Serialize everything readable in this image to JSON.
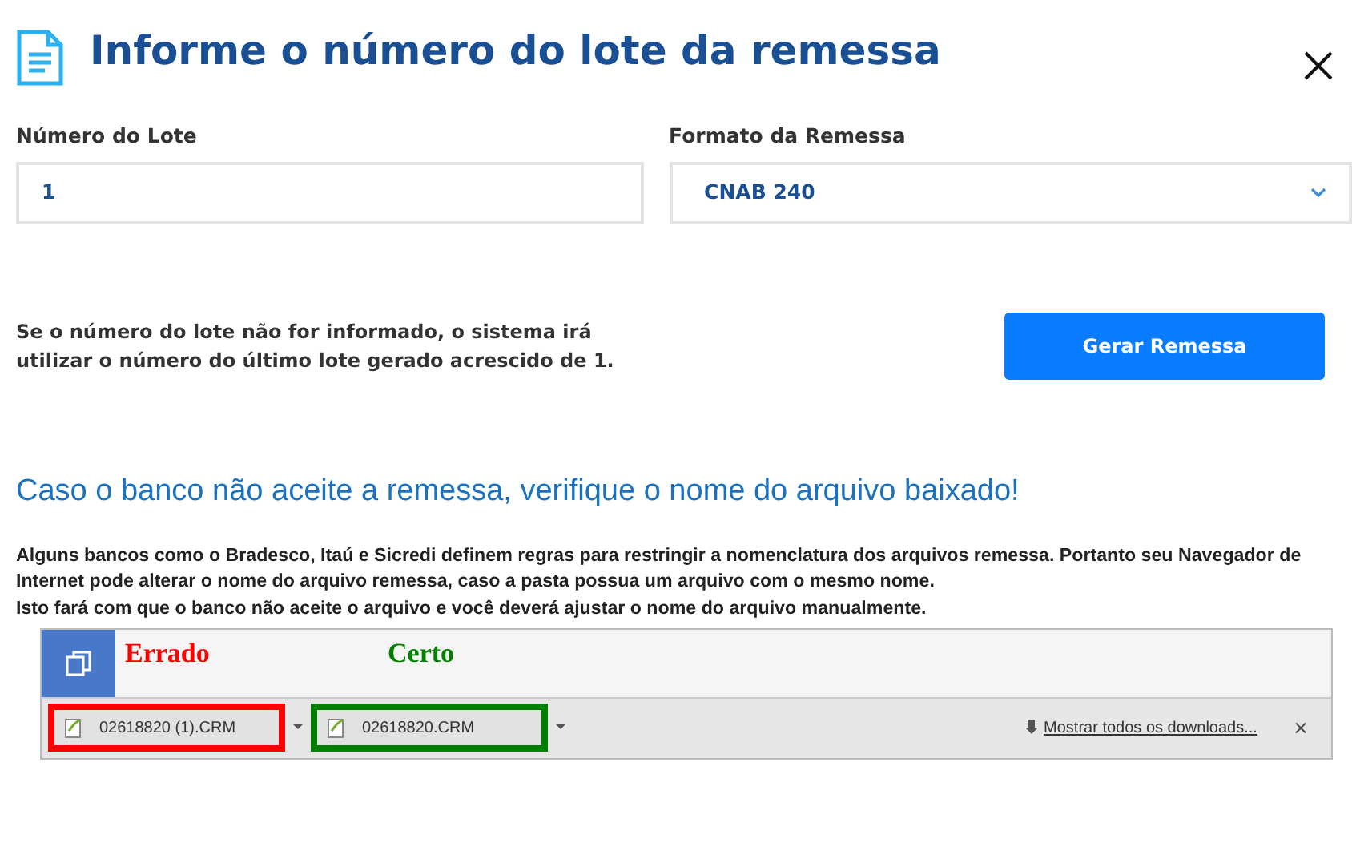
{
  "dialog": {
    "title": "Informe o número do lote da remessa"
  },
  "fields": [
    {
      "kind": "text",
      "label": "Número do Lote",
      "value": "1"
    },
    {
      "kind": "select",
      "label": "Formato da Remessa",
      "value": "CNAB 240"
    }
  ],
  "hint": "Se o número do lote não for informado, o sistema irá utilizar o número do último lote gerado acrescido de 1.",
  "button": "Gerar Remessa",
  "warning": {
    "heading": "Caso o banco não aceite a remessa, verifique o nome do arquivo baixado!",
    "paragraphs": [
      "Alguns bancos como o Bradesco, Itaú e Sicredi definem regras para restringir a nomenclatura dos arquivos remessa. Portanto seu Navegador de Internet pode alterar o nome do arquivo remessa, caso a pasta possua um arquivo com o mesmo nome.",
      "Isto fará com que o banco não aceite o arquivo e você deverá ajustar o nome do arquivo manualmente."
    ]
  },
  "example": {
    "items": [
      {
        "label": "Errado",
        "file": "02618820 (1).CRM",
        "color": "#ff0000"
      },
      {
        "label": "Certo",
        "file": "02618820.CRM",
        "color": "#008000"
      }
    ],
    "show_all": "Mostrar todos os downloads...",
    "close": "×"
  }
}
